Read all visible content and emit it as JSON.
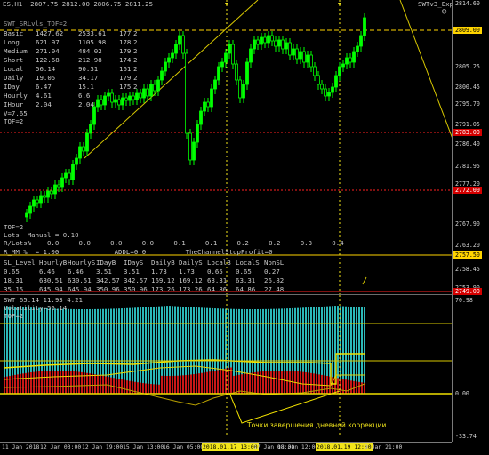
{
  "header": {
    "symbol_line": "ES,H1  2807.75 2812.00 2806.75 2811.25",
    "expert_label": "SWTv3_Exp",
    "smiley": "☺"
  },
  "indicator_title": "SWT_SRLvls_TOF=2",
  "level_table": [
    [
      "Basic",
      "1427.62",
      "2533.61",
      "177",
      "2"
    ],
    [
      "Long",
      "621.97",
      "1105.98",
      "178",
      "2"
    ],
    [
      "Medium",
      "271.04",
      "484.02",
      "179",
      "2"
    ],
    [
      "Short",
      "122.68",
      "212.98",
      "174",
      "2"
    ],
    [
      "Local",
      "56.14",
      "90.31",
      "161",
      "2"
    ],
    [
      "Daily",
      "19.05",
      "34.17",
      "179",
      "2"
    ],
    [
      "IDay",
      "6.47",
      "15.1",
      "175",
      "2"
    ],
    [
      "Hourly",
      "4.61",
      "6.6",
      "",
      ""
    ],
    [
      "IHour",
      "2.04",
      "2.04",
      "",
      ""
    ]
  ],
  "v_line": "V=7.65",
  "tof_line": "TOF=2",
  "lower_info": {
    "tof": "TOF=2",
    "lots": "Lots  Manual = 0.10",
    "rlots": "R/Lots%    0.0     0.0     0.0     0.0     0.1     0.1     0.2     0.2     0.3     0.4",
    "rmm": "R_MM %  = 1.00              ADDL=0.0          TheChannelStopProfit=0"
  },
  "sl_table": {
    "headers": [
      "SL_Level",
      "HourlyB",
      "HourlyS",
      "IDayB",
      "IDayS",
      "DailyB",
      "DailyS",
      "LocalB",
      "LocalS",
      "NonSL"
    ],
    "rows": [
      [
        "0.65",
        "6.46",
        "6.46",
        "3.51",
        "3.51",
        "1.73",
        "1.73",
        "0.65",
        "0.65",
        "0.27"
      ],
      [
        "18.31",
        "630.51",
        "630.51",
        "342.57",
        "342.57",
        "169.12",
        "169.12",
        "63.31",
        "63.31",
        "26.82"
      ],
      [
        "35.15",
        "645.94",
        "645.94",
        "350.96",
        "350.96",
        "173.26",
        "173.26",
        "64.86",
        "64.86",
        "27.48"
      ]
    ]
  },
  "price_axis": {
    "ticks": [
      "2814.60",
      "2805.25",
      "2800.45",
      "2795.70",
      "2791.05",
      "2786.40",
      "2781.95",
      "2777.20",
      "2767.90",
      "2763.20",
      "2758.45",
      "2753.90"
    ],
    "tags": [
      {
        "text": "2809.00",
        "bg": "#ffd400",
        "fg": "#000000"
      },
      {
        "text": "2783.00",
        "bg": "#d40000",
        "fg": "#ffffff"
      },
      {
        "text": "2772.00",
        "bg": "#d40000",
        "fg": "#ffffff"
      },
      {
        "text": "2757.50",
        "bg": "#ffd400",
        "fg": "#000000"
      },
      {
        "text": "2749.00",
        "bg": "#d40000",
        "fg": "#ffffff"
      }
    ]
  },
  "indicator_pane": {
    "title": "SWT 65.14 11.93 4.21",
    "volatility": "Volatility=56.14",
    "tof": "TOF=2",
    "annotation": "Точки завершения дневной коррекции",
    "axis_top": "70.98",
    "axis_zero": "0.00",
    "axis_bottom": "-33.74"
  },
  "time_axis": {
    "labels": [
      "11 Jan 2018",
      "12 Jan 03:00",
      "12 Jan 19:00",
      "15 Jan 13:00",
      "16 Jan 05:00",
      "17 Jan 08:00",
      "18 Jan 12:00",
      "9 Jan 21:00"
    ],
    "highlight_1": "2018.01.17 13:00",
    "highlight_2": "2018.01.19 12:00"
  },
  "colors": {
    "bull_candle": "#00ff00",
    "bear_candle": "#00ff00",
    "trendline": "#d8c800",
    "support": "#ff2020",
    "resistance": "#ffd400",
    "hist_teal": "#2bb8b8",
    "hist_red": "#c81818",
    "hist_yellow": "#f0e000"
  }
}
